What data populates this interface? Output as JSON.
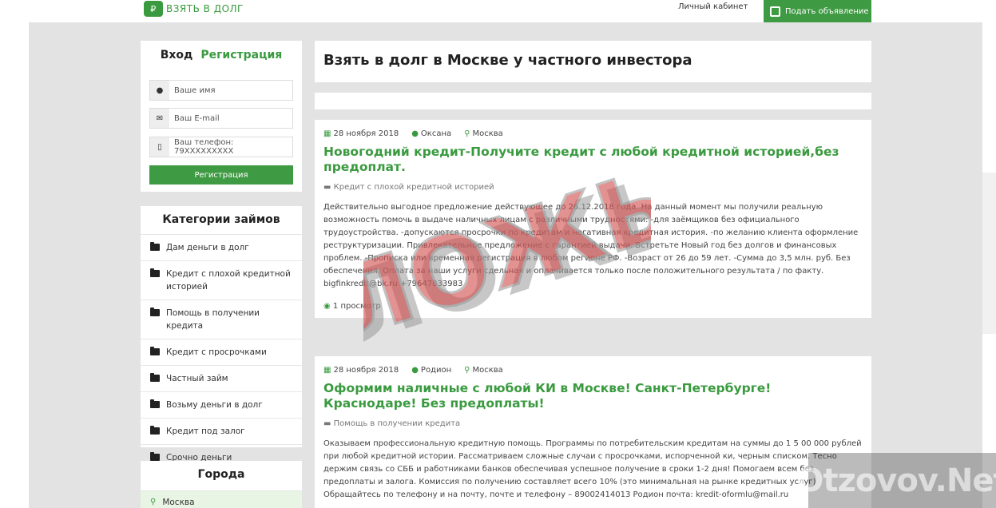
{
  "header": {
    "logo_text": "ВЗЯТЬ В ДОЛГ",
    "cabinet_link": "Личный кабинет",
    "post_button": "Подать объявление"
  },
  "auth": {
    "login_tab": "Вход",
    "register_tab": "Регистрация",
    "name_placeholder": "Ваше имя",
    "email_placeholder": "Ваш E-mail",
    "phone_placeholder": "Ваш телефон: 79XXXXXXXXX",
    "register_button": "Регистрация"
  },
  "categories": {
    "title": "Категории займов",
    "items": [
      "Дам деньги в долг",
      "Кредит с плохой кредитной историей",
      "Помощь в получении кредита",
      "Кредит с просрочками",
      "Частный займ",
      "Возьму деньги в долг",
      "Кредит под залог",
      "Срочно деньги"
    ]
  },
  "cities": {
    "title": "Города",
    "items": [
      "Москва"
    ]
  },
  "main": {
    "page_title": "Взять в долг в Москве у частного инвестора",
    "posts": [
      {
        "date": "28 ноября 2018",
        "author": "Оксана",
        "city": "Москва",
        "title": "Новогодний кредит-Получите кредит с любой кредитной историей,без предоплат.",
        "category": "Кредит с плохой кредитной историей",
        "text": "Действительно выгодное предложение действующее до 26.12.2018 года. На данный момент мы получили реальную возможность помочь в выдаче наличных лицам с различными трудностями: -для заёмщиков без официального трудоустройства. -допускаются просрочки по кредитам и негативная кредитная история. -по желанию клиента оформление реструктуризации. Привлекательное предложение с гарантией выдачи. Встретьте Новый год без долгов и финансовых проблем. -Прописка или временная регистрация в любом регионе РФ. -Возраст от 26 до 59 лет. -Сумма до 3,5 млн. руб. Без обеспечения. Оплата за наши услуги сдельная и оплачивается только после положительного результата / по факту. bigfinkredit@bk.ru +79647833983",
        "views": "1 просмотр"
      },
      {
        "date": "28 ноября 2018",
        "author": "Родион",
        "city": "Москва",
        "title": "Оформим наличные с любой КИ в Москве! Санкт-Петербурге! Краснодаре! Без предоплаты!",
        "category": "Помощь в получении кредита",
        "text": "Оказываем профессиональную кредитную помощь. Программы по потребительским кредитам на суммы до 1 5 00 000 рублей при любой кредитной истории. Рассматриваем сложные случаи с просрочками, испорченной ки, черным списком. Тесно держим связь со СББ и работниками банков обеспечивая успешное получение в сроки 1-2 дня! Помогаем всем без предоплаты и залога. Комиссия по получению составляет всего 10% (это минимальная на рынке кредитных услуг) Обращайтесь по телефону и на почту, почте и телефону – 89002414013 Родион почта: kredit-oformlu@mail.ru"
      }
    ]
  },
  "overlays": {
    "stamp_text": "ЛОЖЬ",
    "watermark_text": "Otzovov.Net"
  },
  "colors": {
    "accent": "#3f9b43",
    "stamp": "#d24a4a"
  },
  "icons": {
    "logo": "money-icon",
    "post": "pencil-icon",
    "name": "user-icon",
    "email": "envelope-icon",
    "phone": "phone-icon",
    "date": "calendar-icon",
    "author": "user-icon",
    "city": "map-pin-icon",
    "category": "folder-icon",
    "views": "eye-icon"
  }
}
